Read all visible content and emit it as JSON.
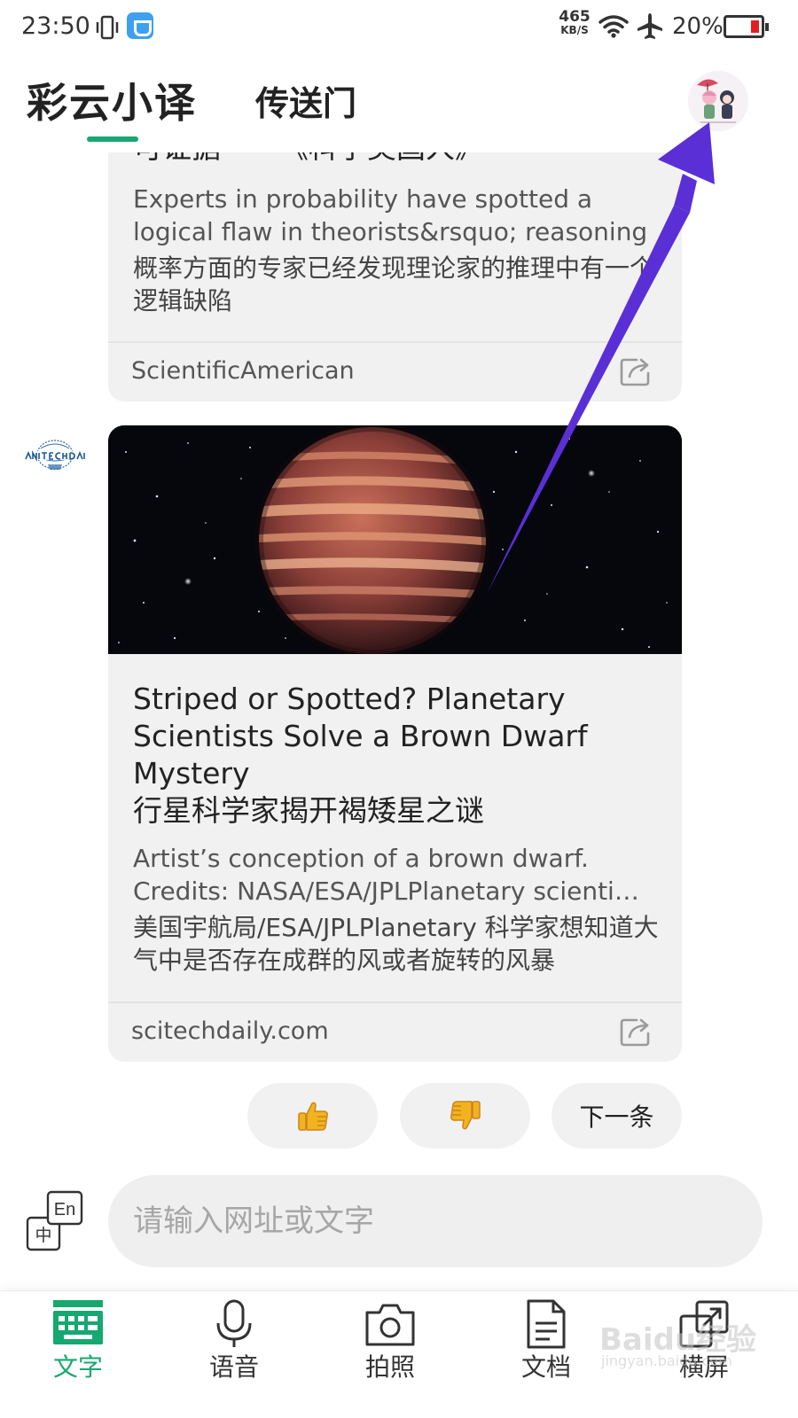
{
  "status_bar": {
    "time": "23:50",
    "net_speed_value": "465",
    "net_speed_unit": "KB/S",
    "battery_percent": "20%"
  },
  "header": {
    "tabs": [
      {
        "label": "彩云小译",
        "active": true
      },
      {
        "label": "传送门",
        "active": false
      }
    ],
    "accent_color": "#16a870"
  },
  "feed": {
    "cards": [
      {
        "title_partial": "可证据——《科学美国人》",
        "excerpt_en": "Experts in probability have spotted a logical flaw in theorists&rsquo; reasoning",
        "excerpt_zh": "概率方面的专家已经发现理论家的推理中有一个逻辑缺陷",
        "source": "ScientificAmerican"
      },
      {
        "title_en": "Striped or Spotted? Planetary Scientists Solve a Brown Dwarf Mystery",
        "title_zh": "行星科学家揭开褐矮星之谜",
        "excerpt_en_line1": "Artist’s conception of a brown dwarf.",
        "excerpt_en_line2": "Credits: NASA/ESA/JPLPlanetary scienti…",
        "excerpt_zh": "美国宇航局/ESA/JPLPlanetary 科学家想知道大气中是否存在成群的风或者旋转的风暴",
        "source": "scitechdaily.com",
        "site_logo_text": "SciTechDaily"
      }
    ]
  },
  "feedback": {
    "like_icon": "thumbs-up-icon",
    "dislike_icon": "thumbs-down-icon",
    "next_label": "下一条"
  },
  "input": {
    "placeholder": "请输入网址或文字",
    "value": "",
    "lang_toggle": {
      "primary": "En",
      "secondary": "中"
    }
  },
  "bottom_nav": {
    "items": [
      {
        "label": "文字",
        "icon": "keyboard-icon",
        "active": true
      },
      {
        "label": "语音",
        "icon": "microphone-icon",
        "active": false
      },
      {
        "label": "拍照",
        "icon": "camera-icon",
        "active": false
      },
      {
        "label": "文档",
        "icon": "document-icon",
        "active": false
      },
      {
        "label": "横屏",
        "icon": "rotate-screen-icon",
        "active": false
      }
    ]
  },
  "watermark": {
    "brand": "Baidu经验",
    "url": "jingyan.baidu.com"
  },
  "colors": {
    "annotation_arrow": "#5a2fd6",
    "icon_gold": "#f3b321"
  }
}
